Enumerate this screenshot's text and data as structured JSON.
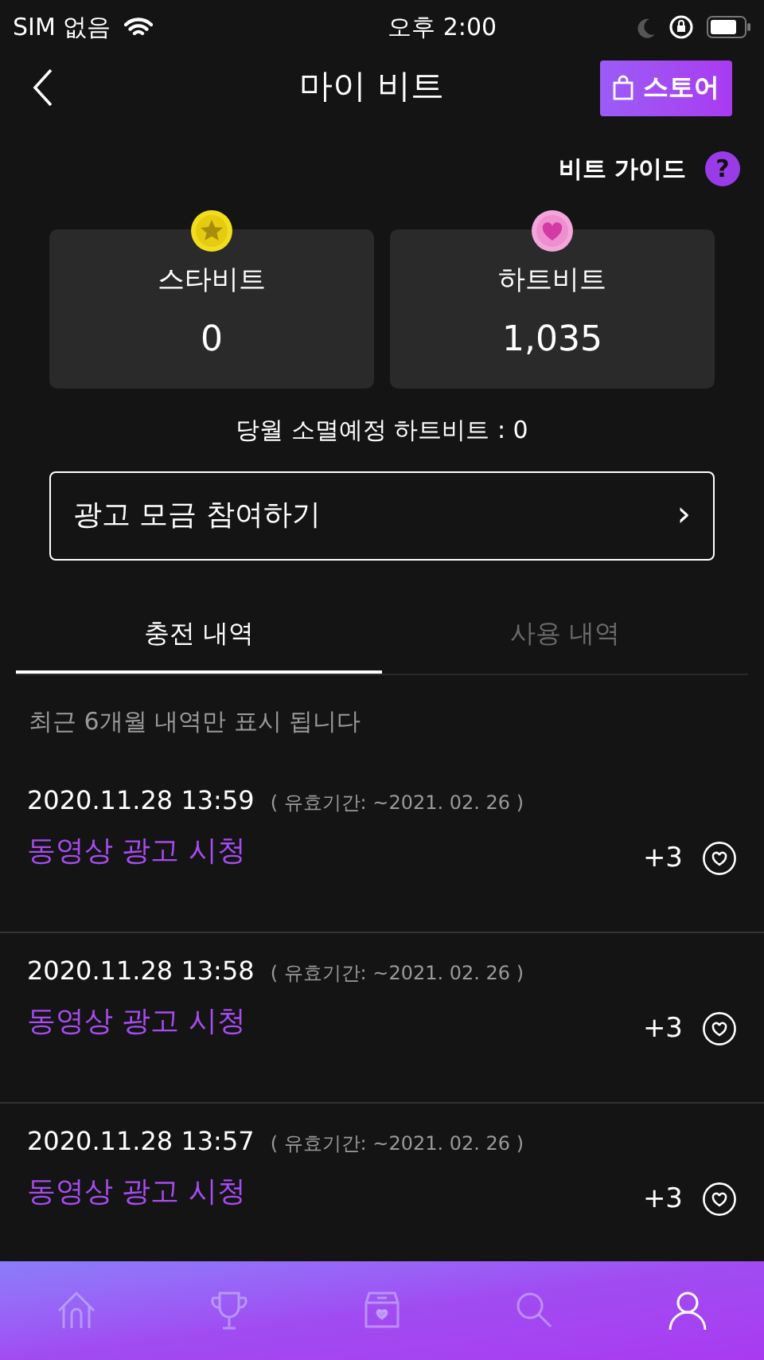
{
  "status_bar": {
    "carrier": "SIM 없음",
    "time": "오후 2:00"
  },
  "header": {
    "title": "마이 비트",
    "store_button": "스토어"
  },
  "guide": {
    "label": "비트 가이드",
    "icon_text": "?"
  },
  "balances": [
    {
      "kind": "star",
      "label": "스타비트",
      "value": "0"
    },
    {
      "kind": "heart",
      "label": "하트비트",
      "value": "1,035"
    }
  ],
  "expiring_note": "당월 소멸예정 하트비트 : 0",
  "ad_button": {
    "label": "광고 모금 참여하기",
    "chevron": "›"
  },
  "tabs": [
    {
      "label": "충전 내역",
      "selected": true
    },
    {
      "label": "사용 내역",
      "selected": false
    }
  ],
  "history_note": "최근 6개월 내역만 표시 됩니다",
  "transactions": [
    {
      "datetime": "2020.11.28 13:59",
      "validity": "( 유효기간: ~2021. 02. 26 )",
      "title": "동영상 광고 시청",
      "amount": "+3"
    },
    {
      "datetime": "2020.11.28 13:58",
      "validity": "( 유효기간: ~2021. 02. 26 )",
      "title": "동영상 광고 시청",
      "amount": "+3"
    },
    {
      "datetime": "2020.11.28 13:57",
      "validity": "( 유효기간: ~2021. 02. 26 )",
      "title": "동영상 광고 시청",
      "amount": "+3"
    }
  ],
  "bottom_nav": [
    {
      "kind": "home",
      "selected": false
    },
    {
      "kind": "trophy",
      "selected": false
    },
    {
      "kind": "box",
      "selected": false
    },
    {
      "kind": "search",
      "selected": false
    },
    {
      "kind": "profile",
      "selected": true
    }
  ]
}
